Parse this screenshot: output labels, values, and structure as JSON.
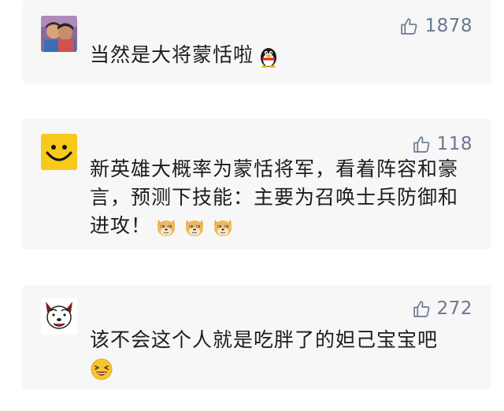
{
  "comments": [
    {
      "avatar": "couple-photo-avatar",
      "likes": "1878",
      "text": "当然是大将蒙恬啦",
      "emojis": [
        "qq-penguin-emoji"
      ]
    },
    {
      "avatar": "smiley-face-avatar",
      "likes": "118",
      "text": "新英雄大概率为蒙恬将军，看着阵容和豪言，预测下技能：主要为召唤士兵防御和进攻！",
      "emojis": [
        "doge-emoji",
        "doge-emoji",
        "doge-emoji"
      ]
    },
    {
      "avatar": "cartoon-dog-avatar",
      "likes": "272",
      "text": "该不会这个人就是吃胖了的妲己宝宝吧",
      "emojis": [
        "laughing-emoji"
      ]
    }
  ]
}
